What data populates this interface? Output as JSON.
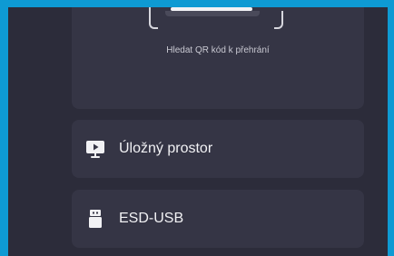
{
  "qr": {
    "caption": "Hledat QR kód k přehrání"
  },
  "sources": [
    {
      "label": "Úložný prostor",
      "icon": "media-player-icon"
    },
    {
      "label": "ESD-USB",
      "icon": "usb-drive-icon"
    }
  ],
  "colors": {
    "frame_accent": "#0e9ad3",
    "background": "#2c2c3a",
    "card": "#353545",
    "text": "#f1f1f4"
  }
}
